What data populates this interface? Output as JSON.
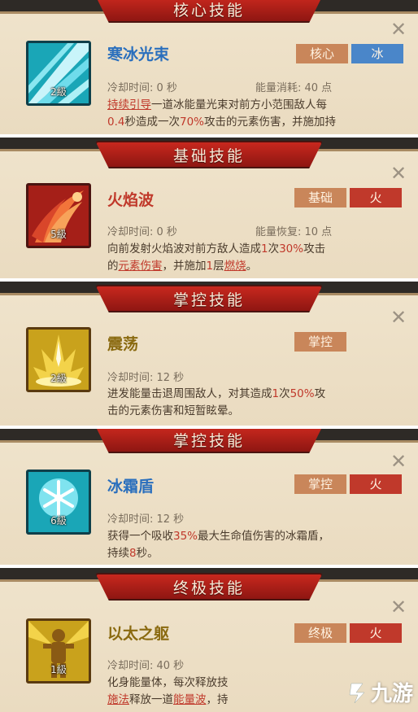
{
  "cards": [
    {
      "category": "核心技能",
      "name": "寒冰光束",
      "level": "2級",
      "tags": [
        "核心",
        "冰"
      ],
      "cooldown": "冷却时间: 0 秒",
      "stat2": "能量消耗: 40 点",
      "desc": {
        "a": "持续引导",
        "b": "一道冰能量光束对前方小范围敌人每",
        "c": "0.4",
        "d": "秒造成一次",
        "e": "70%",
        "f": "攻击的元素伤害，并施加持"
      }
    },
    {
      "category": "基础技能",
      "name": "火焰波",
      "level": "5級",
      "tags": [
        "基础",
        "火"
      ],
      "cooldown": "冷却时间: 0 秒",
      "stat2": "能量恢复: 10 点",
      "desc": {
        "a": "向前发射火焰波对前方敌人造成",
        "b": "1",
        "c": "次",
        "d": "30%",
        "e": "攻击",
        "f": "的",
        "g": "元素伤害",
        "h": "，并施加",
        "i": "1",
        "j": "层",
        "k": "燃烧",
        "l": "。"
      }
    },
    {
      "category": "掌控技能",
      "name": "震荡",
      "level": "2級",
      "tags": [
        "掌控"
      ],
      "cooldown": "冷却时间: 12 秒",
      "desc": {
        "a": "进发能量击退周围敌人，对其造成",
        "b": "1",
        "c": "次",
        "d": "50%",
        "e": "攻",
        "f": "击的元素伤害和短暂眩晕。"
      }
    },
    {
      "category": "掌控技能",
      "name": "冰霜盾",
      "level": "6級",
      "tags": [
        "掌控",
        "火"
      ],
      "cooldown": "冷却时间: 12 秒",
      "desc": {
        "a": "获得一个吸收",
        "b": "35%",
        "c": "最大生命值伤害的冰霜盾，",
        "d": "持续",
        "e": "8",
        "f": "秒。"
      }
    },
    {
      "category": "终极技能",
      "name": "以太之躯",
      "level": "1級",
      "tags": [
        "终极",
        "火"
      ],
      "cooldown": "冷却时间: 40 秒",
      "desc": {
        "a": "化身能量体，每次释放技",
        "b": "施法",
        "c": "释放一道",
        "d": "能量波",
        "e": "，持"
      }
    }
  ],
  "watermark": "九游",
  "colors": {
    "card_bg": "#efe3cb",
    "banner_red": "#c8281e",
    "name_color": "#c0392b",
    "tag_core": "#c9865a",
    "tag_ice": "#4a86c9",
    "tag_fire": "#c0392b"
  }
}
